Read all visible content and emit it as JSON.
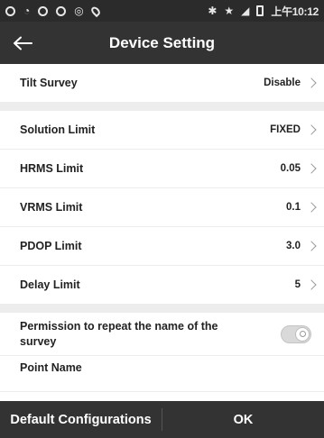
{
  "status_bar": {
    "time": "上午10:12",
    "icons": [
      "notification-icon",
      "wifi-icon",
      "sync-icon",
      "sync-icon",
      "app-icon",
      "location-icon",
      "bluetooth-icon",
      "star-icon",
      "signal-icon",
      "battery-icon"
    ]
  },
  "header": {
    "title": "Device Setting",
    "back_icon": "arrow-left-icon"
  },
  "settings": {
    "tilt_survey": {
      "label": "Tilt Survey",
      "value": "Disable"
    },
    "solution_limit": {
      "label": "Solution Limit",
      "value": "FIXED"
    },
    "hrms_limit": {
      "label": "HRMS Limit",
      "value": "0.05"
    },
    "vrms_limit": {
      "label": "VRMS Limit",
      "value": "0.1"
    },
    "pdop_limit": {
      "label": "PDOP Limit",
      "value": "3.0"
    },
    "delay_limit": {
      "label": "Delay Limit",
      "value": "5"
    },
    "repeat_name": {
      "label": "Permission to repeat the name of the survey",
      "enabled": false
    },
    "point_name": {
      "label": "Point Name"
    }
  },
  "footer": {
    "default_label": "Default Configurations",
    "ok_label": "OK"
  },
  "colors": {
    "bar_background": "#333333",
    "section_gap": "#ededed",
    "toggle_off": "#d9d9d9"
  }
}
